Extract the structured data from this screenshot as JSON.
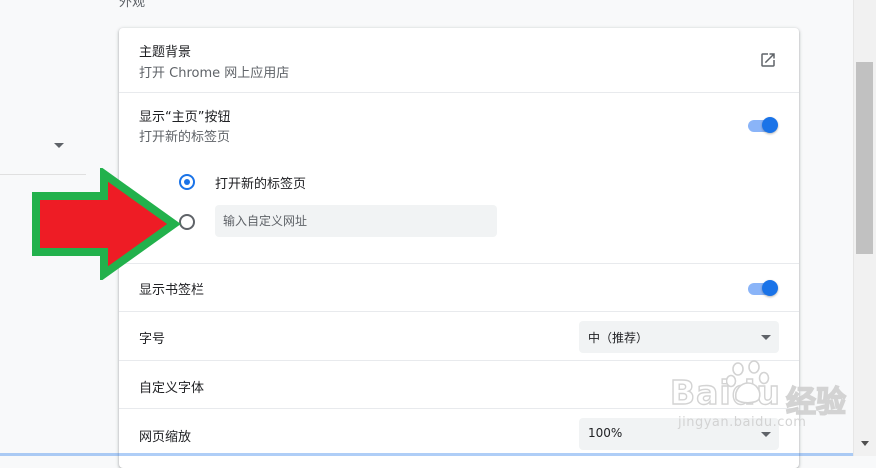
{
  "section": {
    "title": "外观"
  },
  "theme_row": {
    "title": "主题背景",
    "subtitle": "打开 Chrome 网上应用店"
  },
  "home_button_row": {
    "title": "显示“主页”按钮",
    "subtitle": "打开新的标签页",
    "toggle_on": true,
    "options": [
      {
        "label": "打开新的标签页",
        "checked": true
      },
      {
        "placeholder": "输入自定义网址",
        "value": "",
        "checked": false
      }
    ]
  },
  "bookmarks_row": {
    "title": "显示书签栏",
    "toggle_on": true
  },
  "font_size_row": {
    "title": "字号",
    "selected": "中（推荐）"
  },
  "custom_fonts_row": {
    "title": "自定义字体"
  },
  "zoom_row": {
    "title": "网页缩放",
    "selected": "100%"
  },
  "watermark": {
    "logo": "Baidu",
    "brand": "经验",
    "url": "jingyan.baidu.com"
  },
  "colors": {
    "accent": "#1a73e8",
    "toggle_track": "#8ab4f8",
    "arrow_fill": "#ee1c25",
    "arrow_outline": "#22b14c"
  }
}
